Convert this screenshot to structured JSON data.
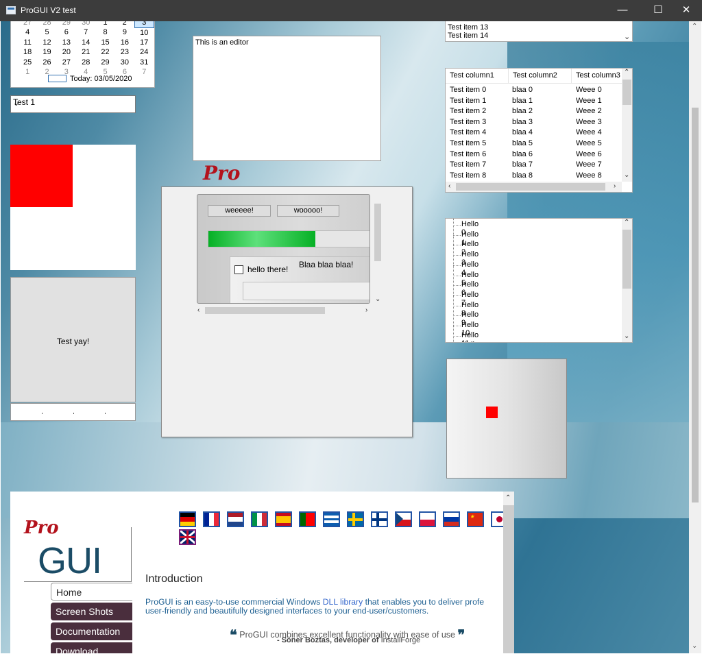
{
  "window": {
    "title": "ProGUI V2 test",
    "minimize": "—",
    "maximize": "☐",
    "close": "✕"
  },
  "calendar": {
    "rows": [
      [
        "27",
        "28",
        "29",
        "30",
        "1",
        "2",
        "3"
      ],
      [
        "4",
        "5",
        "6",
        "7",
        "8",
        "9",
        "10"
      ],
      [
        "11",
        "12",
        "13",
        "14",
        "15",
        "16",
        "17"
      ],
      [
        "18",
        "19",
        "20",
        "21",
        "22",
        "23",
        "24"
      ],
      [
        "25",
        "26",
        "27",
        "28",
        "29",
        "30",
        "31"
      ],
      [
        "1",
        "2",
        "3",
        "4",
        "5",
        "6",
        "7"
      ]
    ],
    "today_label": "Today: 03/05/2020"
  },
  "combo": {
    "value": "Test 1",
    "arrow": "⌄"
  },
  "editor": {
    "text": "This is an editor"
  },
  "container": {
    "button1": "weeeee!",
    "button2": "wooooo!",
    "progress": 0.66,
    "checkbox_label": "hello there!",
    "blaa_label": "Blaa blaa blaa!"
  },
  "testyay": {
    "label": "Test yay!"
  },
  "toplist": {
    "items": [
      "Test item 13",
      "Test item 14"
    ]
  },
  "listview": {
    "columns": [
      "Test column1",
      "Test column2",
      "Test column3"
    ],
    "rows": [
      [
        "Test item 0",
        "blaa 0",
        "Weee 0"
      ],
      [
        "Test item 1",
        "blaa 1",
        "Weee 1"
      ],
      [
        "Test item 2",
        "blaa 2",
        "Weee 2"
      ],
      [
        "Test item 3",
        "blaa 3",
        "Weee 3"
      ],
      [
        "Test item 4",
        "blaa 4",
        "Weee 4"
      ],
      [
        "Test item 5",
        "blaa 5",
        "Weee 5"
      ],
      [
        "Test item 6",
        "blaa 6",
        "Weee 6"
      ],
      [
        "Test item 7",
        "blaa 7",
        "Weee 7"
      ],
      [
        "Test item 8",
        "blaa 8",
        "Weee 8"
      ]
    ]
  },
  "tree": {
    "items": [
      "Hello 0",
      "Hello 1",
      "Hello 2",
      "Hello 3",
      "Hello 4",
      "Hello 5",
      "Hello 6",
      "Hello 7",
      "Hello 8",
      "Hello 9",
      "Hello 10",
      "Hello 11",
      "Hello 12"
    ]
  },
  "browser": {
    "logo_pro": "Pro",
    "logo_gui": "GUI",
    "nav": [
      "Home",
      "Screen Shots",
      "Documentation",
      "Download"
    ],
    "heading": "Introduction",
    "intro_1a": "ProGUI is an easy-to-use commercial Windows ",
    "intro_1link": "DLL library",
    "intro_1b": " that enables you to deliver profe",
    "intro_2": "user-friendly and beautifully designed interfaces to your end-user/customers.",
    "quote_open": "❝",
    "quote": " ProGUI combines excellent functionality with ease of use ",
    "quote_close": "❞",
    "author_prefix": "- Soner Boztas, developer of ",
    "author_product": "InstallForge",
    "flags": [
      "germany",
      "france",
      "netherlands",
      "italy",
      "spain",
      "portugal",
      "greece",
      "sweden",
      "finland",
      "czech",
      "poland",
      "russia",
      "china",
      "japan",
      "uk"
    ]
  },
  "colors": {
    "accent": "#2153a4",
    "progress": "#06b025",
    "red": "#ff0000",
    "nav_bg": "#4a2e3d"
  }
}
